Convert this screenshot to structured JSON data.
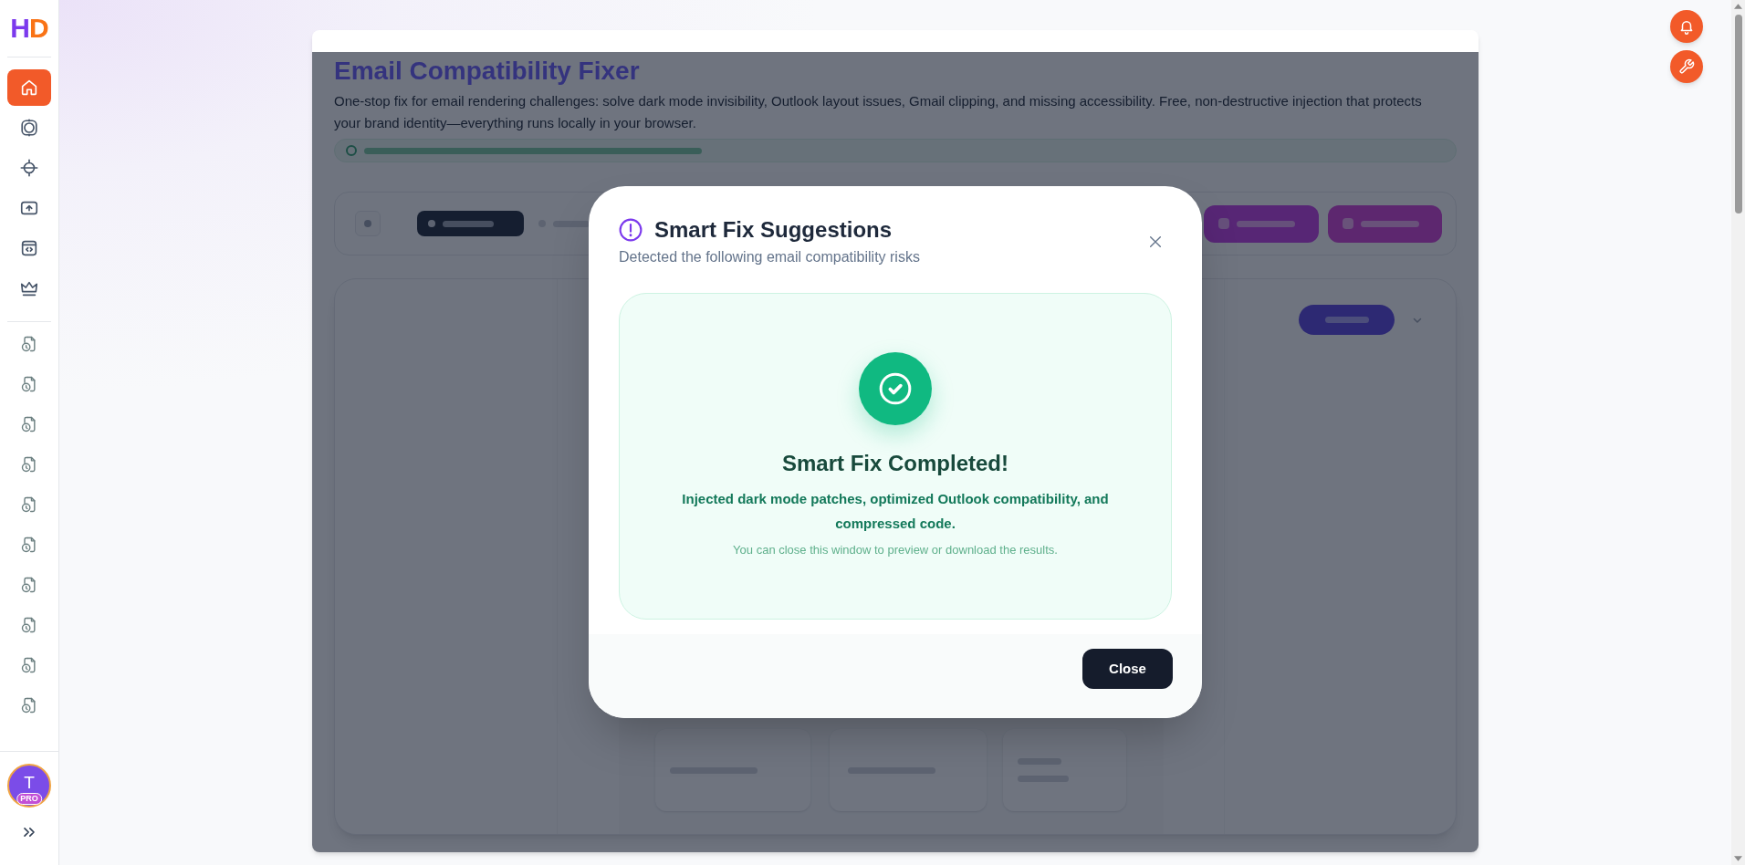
{
  "sidebar": {
    "logo": "HD",
    "nav_items": [
      {
        "kind": "home",
        "selected": true
      },
      {
        "kind": "lens",
        "selected": false
      },
      {
        "kind": "crosshair",
        "selected": false
      },
      {
        "kind": "upload",
        "selected": false
      },
      {
        "kind": "code",
        "selected": false
      },
      {
        "kind": "crown",
        "selected": false
      }
    ],
    "history_items": [
      {
        "selected": false
      },
      {
        "selected": false
      },
      {
        "selected": false
      },
      {
        "selected": false
      },
      {
        "selected": false
      },
      {
        "selected": false
      },
      {
        "selected": false
      },
      {
        "selected": false
      },
      {
        "selected": false
      },
      {
        "selected": false
      }
    ],
    "user": {
      "initial": "T",
      "badge": "PRO"
    }
  },
  "background_page": {
    "title": "Email Compatibility Fixer",
    "description": "One-stop fix for email rendering challenges: solve dark mode invisibility, Outlook layout issues, Gmail clipping, and missing accessibility. Free, non-destructive injection that protects your brand identity—everything runs locally in your browser."
  },
  "dialog": {
    "title": "Smart Fix Suggestions",
    "subtitle": "Detected the following email compatibility risks",
    "result": {
      "heading": "Smart Fix Completed!",
      "message": "Injected dark mode patches, optimized Outlook compatibility, and compressed code.",
      "hint": "You can close this window to preview or download the results."
    },
    "buttons": [
      {
        "label": "Close",
        "kind": "primary"
      }
    ]
  }
}
